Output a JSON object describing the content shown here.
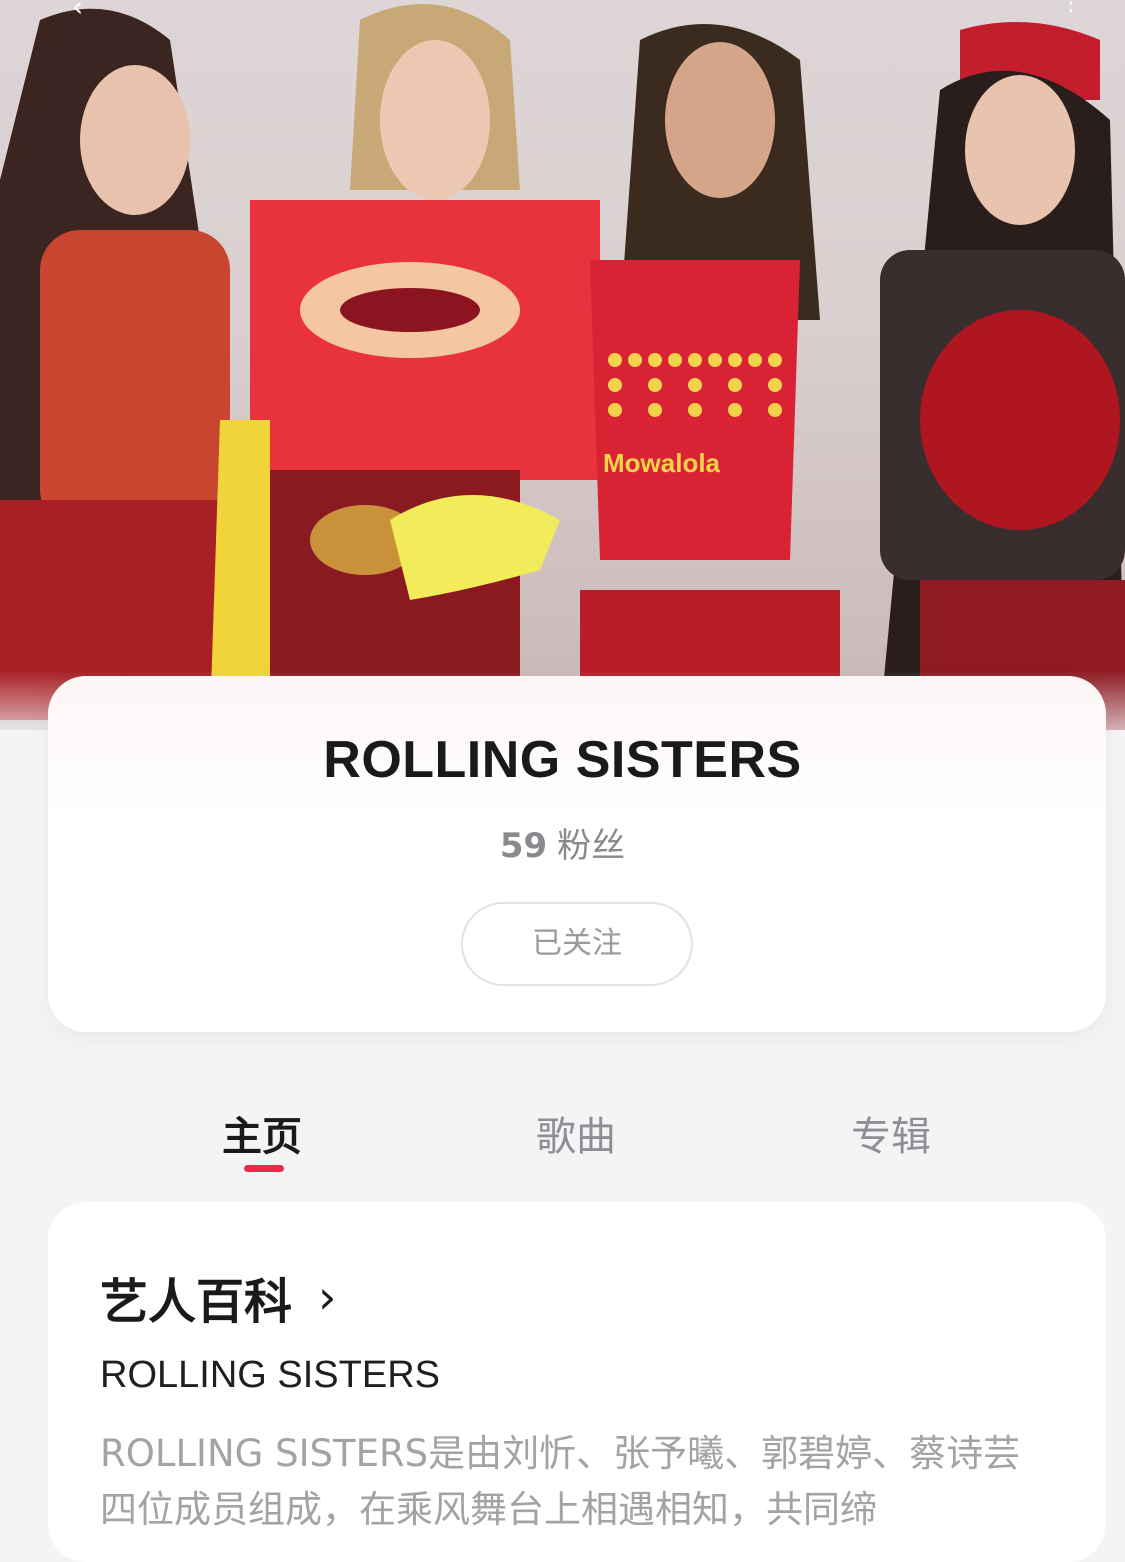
{
  "header": {
    "back_icon": "chevron-left-icon",
    "more_icon": "more-vertical-icon"
  },
  "hero": {
    "image": "group-photo-of-four-members"
  },
  "artist": {
    "name": "ROLLING SISTERS",
    "fans_count": "59",
    "fans_label": "粉丝",
    "follow_label": "已关注"
  },
  "tabs": [
    {
      "label": "主页",
      "active": true
    },
    {
      "label": "歌曲",
      "active": false
    },
    {
      "label": "专辑",
      "active": false
    }
  ],
  "wiki": {
    "title": "艺人百科",
    "chevron": "›",
    "subtitle": "ROLLING SISTERS",
    "description": "ROLLING SISTERS是由刘忻、张予曦、郭碧婷、蔡诗芸四位成员组成，在乘风舞台上相遇相知，共同缔"
  },
  "colors": {
    "accent": "#ee2b47",
    "background": "#f4f4f6"
  }
}
